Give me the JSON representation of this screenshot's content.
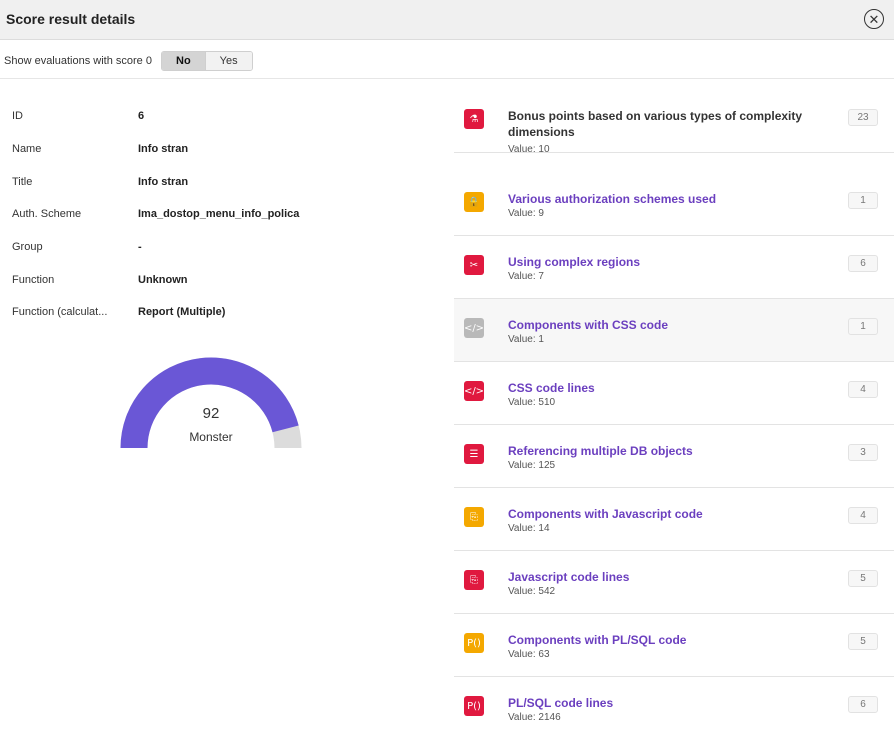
{
  "dialog": {
    "title": "Score result details",
    "close_glyph": "✕"
  },
  "toolbar": {
    "label": "Show evaluations with score 0",
    "options": [
      "No",
      "Yes"
    ],
    "selected": "No"
  },
  "properties": [
    {
      "key": "ID",
      "value": "6"
    },
    {
      "key": "Name",
      "value": "Info stran"
    },
    {
      "key": "Title",
      "value": "Info stran"
    },
    {
      "key": "Auth. Scheme",
      "value": "Ima_dostop_menu_info_polica"
    },
    {
      "key": "Group",
      "value": "-"
    },
    {
      "key": "Function",
      "value": "Unknown"
    },
    {
      "key": "Function (calculat...",
      "value": "Report (Multiple)"
    }
  ],
  "gauge": {
    "score": "92",
    "level": "Monster",
    "fraction": 0.92,
    "fill_color": "#6a57d6",
    "track_color": "#dcdcdc"
  },
  "evaluations": [
    {
      "name": "Bonus points based on various types of complexity dimensions",
      "value_label": "Value: 10",
      "score": "23",
      "icon": "flask-icon",
      "icon_glyph": "⚗",
      "icon_color": "#e0193f",
      "name_color": "#333333",
      "highlighted": false
    },
    {
      "name": "Various authorization schemes used",
      "value_label": "Value: 9",
      "score": "1",
      "icon": "lock-a-icon",
      "icon_glyph": "🔒",
      "icon_color": "#f4a800",
      "name_color": "#6b3fbf",
      "highlighted": false
    },
    {
      "name": "Using complex regions",
      "value_label": "Value: 7",
      "score": "6",
      "icon": "scissors-icon",
      "icon_glyph": "✂",
      "icon_color": "#e0193f",
      "name_color": "#6b3fbf",
      "highlighted": false
    },
    {
      "name": "Components with CSS code",
      "value_label": "Value: 1",
      "score": "1",
      "icon": "code-icon",
      "icon_glyph": "</>",
      "icon_color": "#b9b9b9",
      "name_color": "#6b3fbf",
      "highlighted": true
    },
    {
      "name": "CSS code lines",
      "value_label": "Value: 510",
      "score": "4",
      "icon": "code-icon",
      "icon_glyph": "</>",
      "icon_color": "#e0193f",
      "name_color": "#6b3fbf",
      "highlighted": false
    },
    {
      "name": "Referencing multiple DB objects",
      "value_label": "Value: 125",
      "score": "3",
      "icon": "database-icon",
      "icon_glyph": "☰",
      "icon_color": "#e0193f",
      "name_color": "#6b3fbf",
      "highlighted": false
    },
    {
      "name": "Components with Javascript code",
      "value_label": "Value: 14",
      "score": "4",
      "icon": "js-file-icon",
      "icon_glyph": "⎘",
      "icon_color": "#f4a800",
      "name_color": "#6b3fbf",
      "highlighted": false
    },
    {
      "name": "Javascript code lines",
      "value_label": "Value: 542",
      "score": "5",
      "icon": "js-file-icon",
      "icon_glyph": "⎘",
      "icon_color": "#e0193f",
      "name_color": "#6b3fbf",
      "highlighted": false
    },
    {
      "name": "Components with PL/SQL code",
      "value_label": "Value: 63",
      "score": "5",
      "icon": "plsql-icon",
      "icon_glyph": "P()",
      "icon_color": "#f4a800",
      "name_color": "#6b3fbf",
      "highlighted": false
    },
    {
      "name": "PL/SQL code lines",
      "value_label": "Value: 2146",
      "score": "6",
      "icon": "plsql-icon",
      "icon_glyph": "P()",
      "icon_color": "#e0193f",
      "name_color": "#6b3fbf",
      "highlighted": false
    }
  ]
}
